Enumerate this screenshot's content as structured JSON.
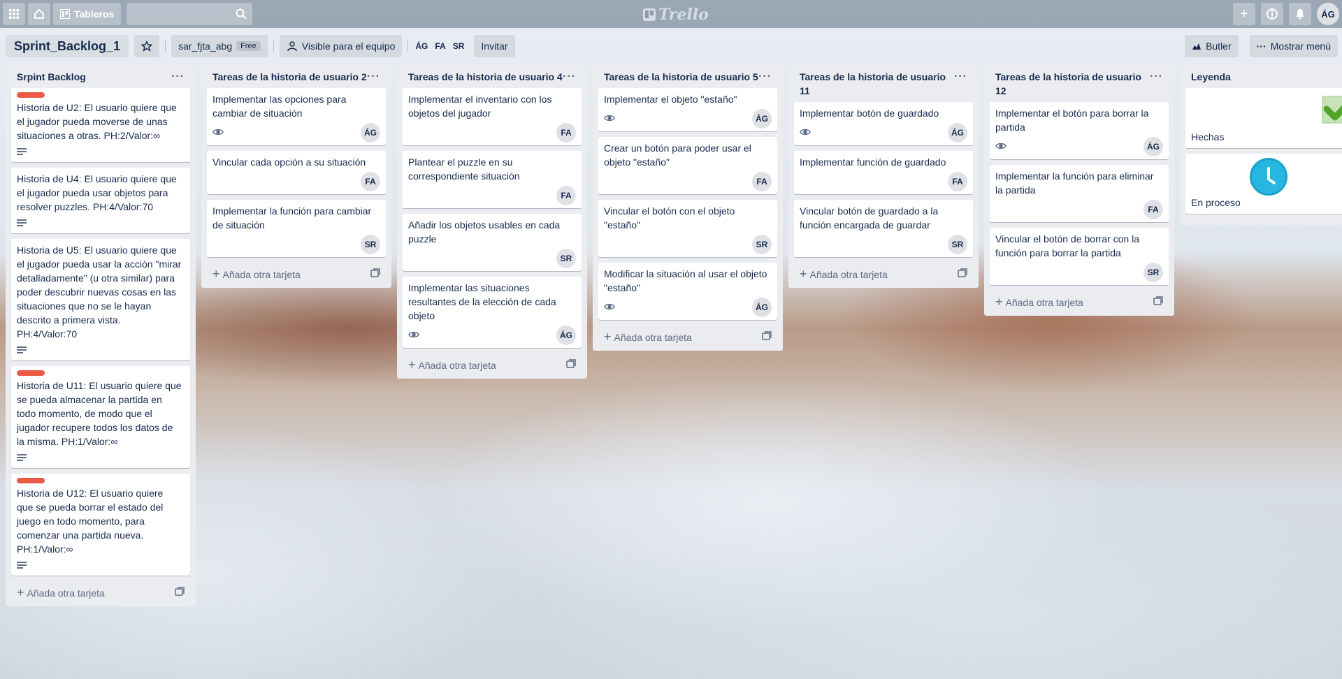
{
  "header": {
    "boards_label": "Tableros",
    "logo_text": "Trello",
    "user_initials": "ÁG"
  },
  "board": {
    "title": "Sprint_Backlog_1",
    "team": "sar_fjta_abg",
    "plan": "Free",
    "visibility": "Visible para el equipo",
    "members": [
      "ÁG",
      "FA",
      "SR"
    ],
    "invite": "Invitar",
    "butler": "Butler",
    "menu": "Mostrar menú"
  },
  "add_card_label": "Añada otra tarjeta",
  "lists": [
    {
      "title": "Srpint Backlog",
      "cards": [
        {
          "text": "Historia de U2: El usuario quiere que el jugador pueda moverse de unas situaciones a otras. PH:2/Valor:∞",
          "label": true,
          "desc": true,
          "member": ""
        },
        {
          "text": "Historia de U4: El usuario quiere que el jugador pueda usar objetos para resolver puzzles. PH:4/Valor:70",
          "label": false,
          "desc": true,
          "member": ""
        },
        {
          "text": "Historia de U5: El usuario quiere que el jugador pueda usar la acción \"mirar detalladamente\" (u otra similar) para poder descubrir nuevas cosas en las situaciones que no se le hayan descrito a primera vista. PH:4/Valor:70",
          "label": false,
          "desc": true,
          "member": ""
        },
        {
          "text": "Historia de U11: El usuario quiere que se pueda almacenar la partida en todo momento, de modo que el jugador recupere todos los datos de la misma. PH:1/Valor:∞",
          "label": true,
          "desc": true,
          "member": ""
        },
        {
          "text": "Historia de U12: El usuario quiere que se pueda borrar el estado del juego en todo momento, para comenzar una partida nueva. PH:1/Valor:∞",
          "label": true,
          "desc": true,
          "member": ""
        }
      ]
    },
    {
      "title": "Tareas de la historia de usuario 2",
      "cards": [
        {
          "text": "Implementar las opciones para cambiar de situación",
          "watch": true,
          "member": "ÁG"
        },
        {
          "text": "Vincular cada opción a su situación",
          "member": "FA"
        },
        {
          "text": "Implementar la función para cambiar de situación",
          "member": "SR"
        }
      ]
    },
    {
      "title": "Tareas de la historia de usuario 4",
      "cards": [
        {
          "text": "Implementar el inventario con los objetos del jugador",
          "member": "FA"
        },
        {
          "text": "Plantear el puzzle en su correspondiente situación",
          "member": "FA"
        },
        {
          "text": "Añadir los objetos usables en cada puzzle",
          "member": "SR"
        },
        {
          "text": "Implementar las situaciones resultantes de la elección de cada objeto",
          "watch": true,
          "member": "ÁG"
        }
      ]
    },
    {
      "title": "Tareas de la historia de usuario 5",
      "cards": [
        {
          "text": "Implementar el objeto \"estaño\"",
          "watch": true,
          "member": "ÁG"
        },
        {
          "text": "Crear un botón para poder usar el objeto \"estaño\"",
          "member": "FA"
        },
        {
          "text": "Vincular el botón con el objeto \"estaño\"",
          "member": "SR"
        },
        {
          "text": "Modificar la situación al usar el objeto \"estaño\"",
          "watch": true,
          "member": "ÁG"
        }
      ]
    },
    {
      "title": "Tareas de la historia de usuario 11",
      "cards": [
        {
          "text": "Implementar botón de guardado",
          "watch": true,
          "member": "ÁG"
        },
        {
          "text": "Implementar función de guardado",
          "member": "FA"
        },
        {
          "text": "Vincular botón de guardado a la función encargada de guardar",
          "member": "SR"
        }
      ]
    },
    {
      "title": "Tareas de la historia de usuario 12",
      "cards": [
        {
          "text": "Implementar el botón para borrar la partida",
          "watch": true,
          "member": "ÁG"
        },
        {
          "text": "Implementar la función para eliminar la partida",
          "member": "FA"
        },
        {
          "text": "Vincular el botón de borrar con la función para borrar la partida",
          "member": "SR"
        }
      ]
    },
    {
      "title": "Leyenda",
      "legend": [
        {
          "text": "Hechas",
          "icon": "checkmark-icon"
        },
        {
          "text": "En proceso",
          "icon": "clock-icon"
        }
      ]
    }
  ]
}
